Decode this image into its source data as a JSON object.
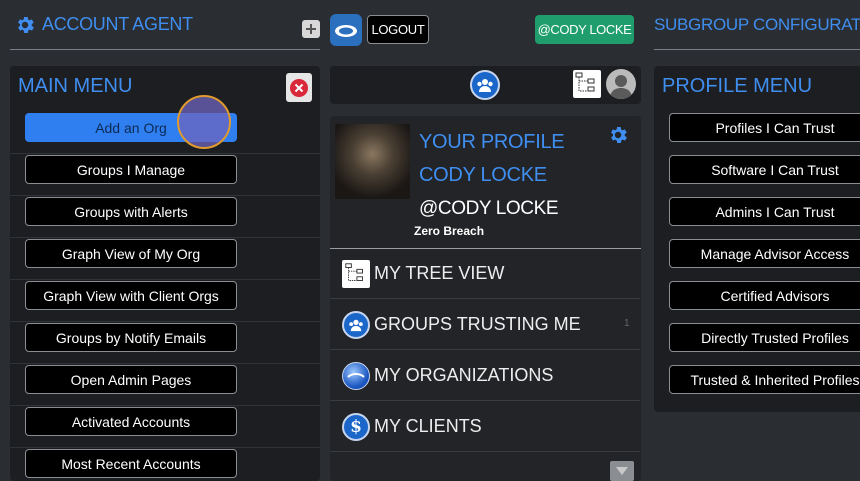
{
  "left": {
    "top_title": "ACCOUNT AGENT",
    "panel_title": "MAIN MENU",
    "menu": [
      "Add an Org",
      "Groups I Manage",
      "Groups with Alerts",
      "Graph View of My Org",
      "Graph View with Client Orgs",
      "Groups by Notify Emails",
      "Open Admin Pages",
      "Activated Accounts",
      "Most Recent Accounts"
    ]
  },
  "middle": {
    "logout_label": "LOGOUT",
    "user_badge": "@CODY LOCKE",
    "profile": {
      "heading1": "YOUR PROFILE",
      "heading2": "CODY LOCKE",
      "handle": "@CODY LOCKE",
      "org": "Zero Breach"
    },
    "nav": [
      {
        "label": "MY TREE VIEW",
        "icon": "tree-view-icon",
        "count": ""
      },
      {
        "label": "GROUPS TRUSTING ME",
        "icon": "groups-icon",
        "count": "1"
      },
      {
        "label": "MY ORGANIZATIONS",
        "icon": "organizations-globe-icon",
        "count": ""
      },
      {
        "label": "MY CLIENTS",
        "icon": "clients-dollar-icon",
        "count": ""
      }
    ]
  },
  "right": {
    "top_title": "SUBGROUP CONFIGURATIO",
    "panel_title": "PROFILE MENU",
    "menu": [
      "Profiles I Can Trust",
      "Software I Can Trust",
      "Admins I Can Trust",
      "Manage Advisor Access",
      "Certified Advisors",
      "Directly Trusted Profiles",
      "Trusted & Inherited Profiles"
    ]
  },
  "colors": {
    "accent": "#3f8ef0",
    "badge_green": "#1f9d6d",
    "close_red": "#d8283a",
    "background": "#2a2d32"
  }
}
